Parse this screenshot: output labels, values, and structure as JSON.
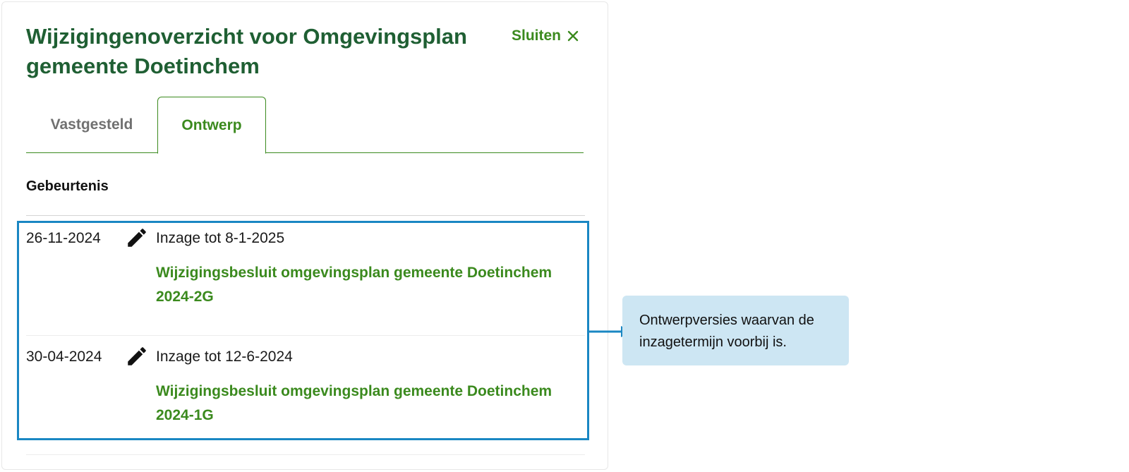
{
  "panel": {
    "title": "Wijzigingenoverzicht voor Omgevingsplan gemeente Doetinchem",
    "close_label": "Sluiten"
  },
  "tabs": [
    {
      "label": "Vastgesteld",
      "active": false
    },
    {
      "label": "Ontwerp",
      "active": true
    }
  ],
  "section": {
    "header": "Gebeurtenis"
  },
  "events": [
    {
      "date": "26-11-2024",
      "icon": "pencil-icon",
      "inzage": "Inzage tot 8-1-2025",
      "link": "Wijzigingsbesluit omgevingsplan gemeente Doetinchem 2024-2G"
    },
    {
      "date": "30-04-2024",
      "icon": "pencil-icon",
      "inzage": "Inzage tot 12-6-2024",
      "link": "Wijzigingsbesluit omgevingsplan gemeente Doetinchem 2024-1G"
    }
  ],
  "annotation": {
    "text": "Ontwerpversies waarvan de inzagetermijn voorbij is.",
    "color_border": "#1a87c3",
    "color_background": "#cde6f3"
  },
  "colors": {
    "title": "#1f5f33",
    "accent": "#3b8a1e",
    "inactive_tab": "#707070"
  }
}
